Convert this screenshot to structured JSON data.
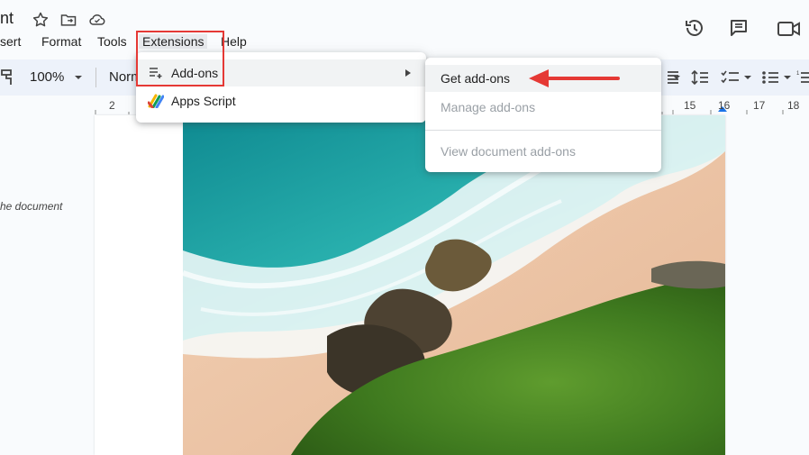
{
  "window": {
    "title_fragment": "nt",
    "icons": [
      "star-icon",
      "move-to-folder-icon",
      "cloud-saved-icon",
      "history-icon",
      "comments-icon",
      "meet-camera-icon"
    ]
  },
  "menubar": {
    "items": [
      "sert",
      "Format",
      "Tools",
      "Extensions",
      "Help"
    ]
  },
  "toolbar": {
    "zoom": "100%",
    "style_fragment": "Norm"
  },
  "ruler": {
    "ticks": [
      "2",
      "15",
      "16",
      "17",
      "18"
    ]
  },
  "sidebar": {
    "outline_text": "he document"
  },
  "extensions_menu": {
    "items": [
      {
        "label": "Add-ons",
        "icon": "add-ons-icon",
        "has_submenu": true
      },
      {
        "label": "Apps Script",
        "icon": "apps-script-icon",
        "has_submenu": false
      }
    ]
  },
  "addons_submenu": {
    "items": [
      {
        "label": "Get add-ons",
        "enabled": true
      },
      {
        "label": "Manage add-ons",
        "enabled": false
      },
      {
        "label": "View document add-ons",
        "enabled": false
      }
    ]
  },
  "colors": {
    "highlight": "#e53935",
    "arrow": "#e53935",
    "toolbar_bg": "#edf2fa",
    "disabled_text": "#9aa0a6"
  }
}
